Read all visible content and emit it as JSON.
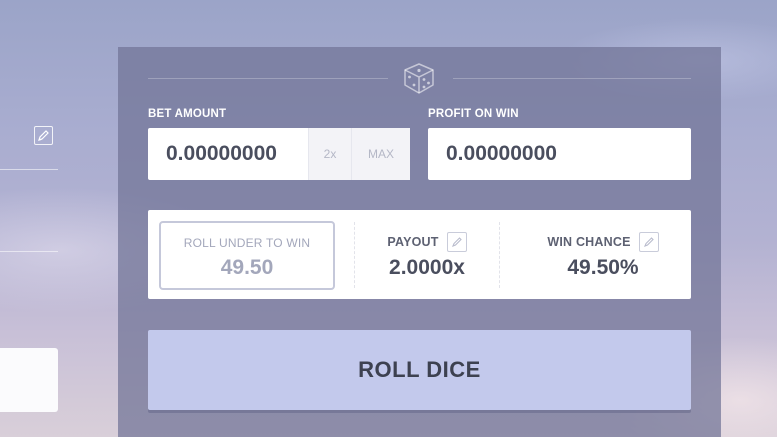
{
  "bet": {
    "label": "BET AMOUNT",
    "value": "0.00000000",
    "double_label": "2x",
    "max_label": "MAX"
  },
  "profit": {
    "label": "PROFIT ON WIN",
    "value": "0.00000000"
  },
  "roll_under": {
    "label": "ROLL UNDER TO WIN",
    "value": "49.50"
  },
  "payout": {
    "label": "PAYOUT",
    "value": "2.0000x"
  },
  "win_chance": {
    "label": "WIN CHANCE",
    "value": "49.50%"
  },
  "roll_button": {
    "label": "ROLL DICE"
  },
  "icons": {
    "divider": "dice-icon",
    "left_edit": "pencil-icon",
    "payout_edit": "pencil-icon",
    "chance_edit": "pencil-icon"
  },
  "colors": {
    "roll_button_bg": "#c3c9ec",
    "panel_bg": "#70739a",
    "value_text": "#4a4e5e",
    "muted_text": "#a3a7bb"
  }
}
